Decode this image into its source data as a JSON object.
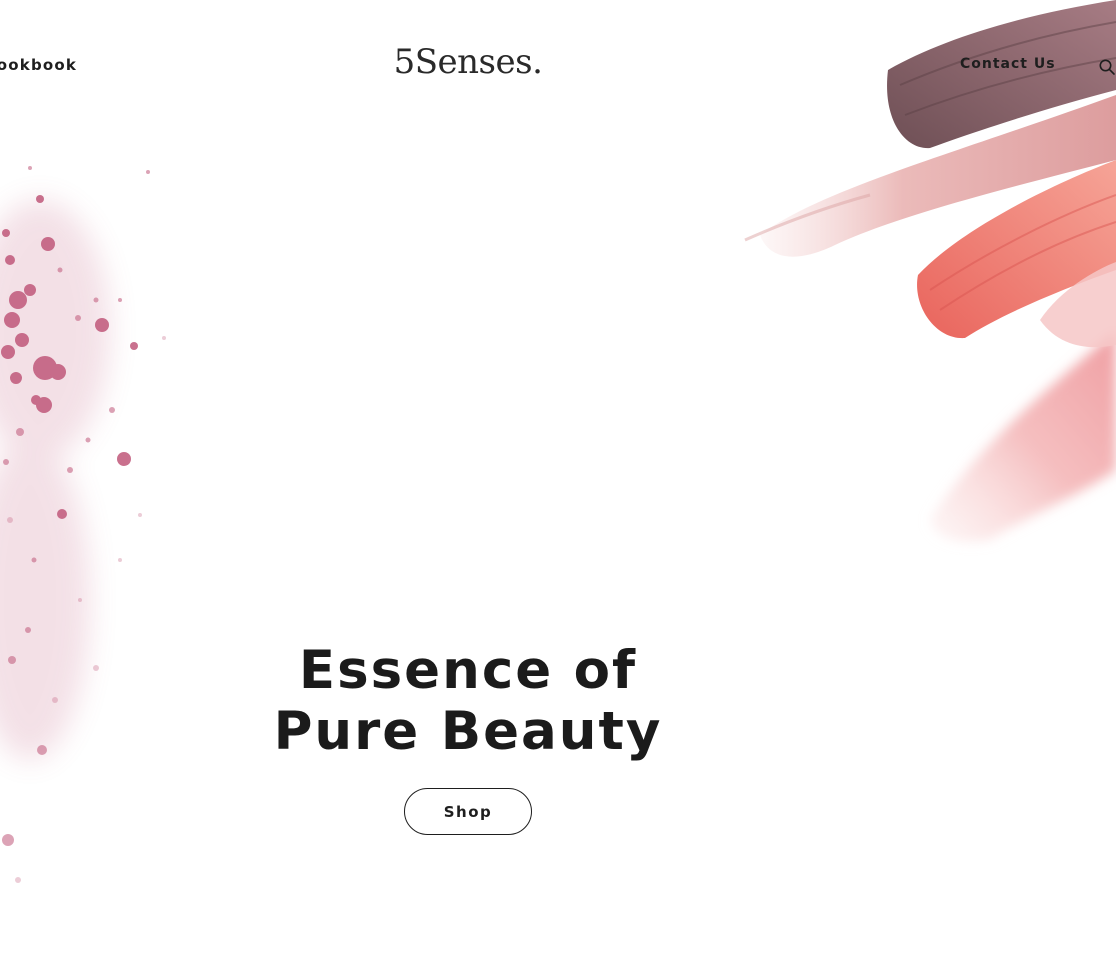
{
  "header": {
    "nav_left_label": "Lookbook",
    "logo_text": "5Senses.",
    "nav_right_label": "Contact Us",
    "search_icon": "search-icon"
  },
  "hero": {
    "title_line1": "Essence of",
    "title_line2": "Pure Beauty",
    "cta_label": "Shop"
  },
  "colors": {
    "text": "#1e1e1e",
    "background": "#ffffff",
    "powder_pink": "#c0587a",
    "brush_mauve": "#7e5c60",
    "brush_coral": "#ec7a70",
    "brush_blush": "#f0a8a8"
  }
}
